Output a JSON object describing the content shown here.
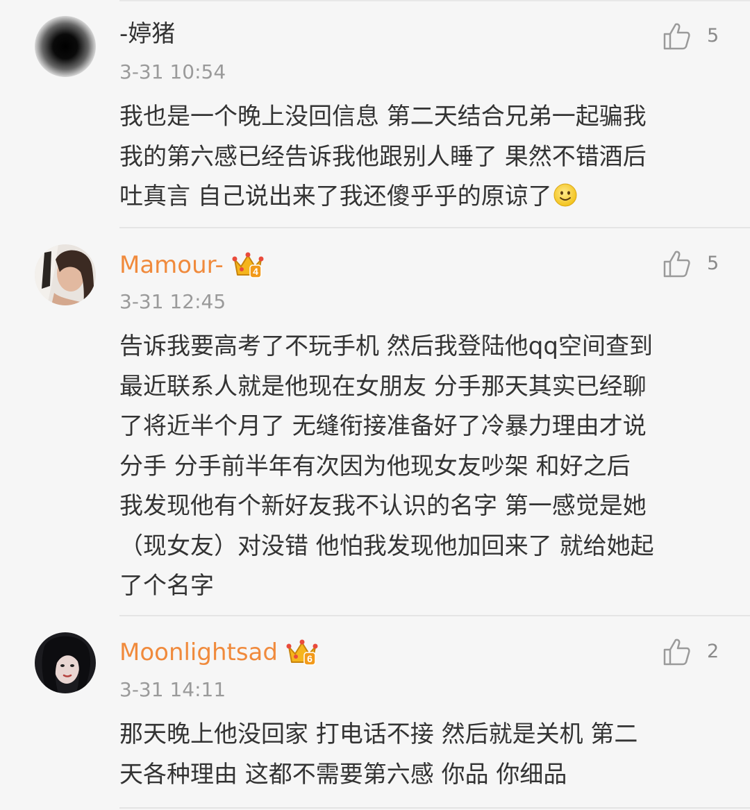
{
  "comments": [
    {
      "username": "-婷猪",
      "time": "3-31 10:54",
      "likes": "5",
      "avatar_icon": "blurred-dark-avatar-icon",
      "lines": [
        "我也是一个晚上没回信息 第二天结合兄弟一起骗我",
        "我的第六感已经告诉我他跟别人睡了 果然不错酒后",
        "吐真言 自己说出来了我还傻乎乎的原谅了"
      ],
      "emoji": "smile-emoji-icon"
    },
    {
      "username": "Mamour-",
      "time": "3-31 12:45",
      "likes": "5",
      "vip_level": "4",
      "avatar_icon": "portrait-avatar-icon",
      "lines": [
        "告诉我要高考了不玩手机 然后我登陆他qq空间查到",
        "最近联系人就是他现在女朋友 分手那天其实已经聊",
        "了将近半个月了 无缝衔接准备好了冷暴力理由才说",
        "分手  分手前半年有次因为他现女友吵架 和好之后",
        "我发现他有个新好友我不认识的名字 第一感觉是她",
        "（现女友）对没错 他怕我发现他加回来了 就给她起",
        "了个名字"
      ]
    },
    {
      "username": "Moonlightsad",
      "time": "3-31 14:11",
      "likes": "2",
      "vip_level": "6",
      "avatar_icon": "portrait-avatar-icon",
      "lines": [
        "那天晚上他没回家 打电话不接 然后就是关机 第二",
        "天各种理由 这都不需要第六感 你品 你细品"
      ]
    }
  ],
  "colors": {
    "background": "#f6f6f6",
    "vip_name": "#f08a3c",
    "time": "#9a9a9a",
    "text": "#333333",
    "crown": "#f5b51d"
  }
}
